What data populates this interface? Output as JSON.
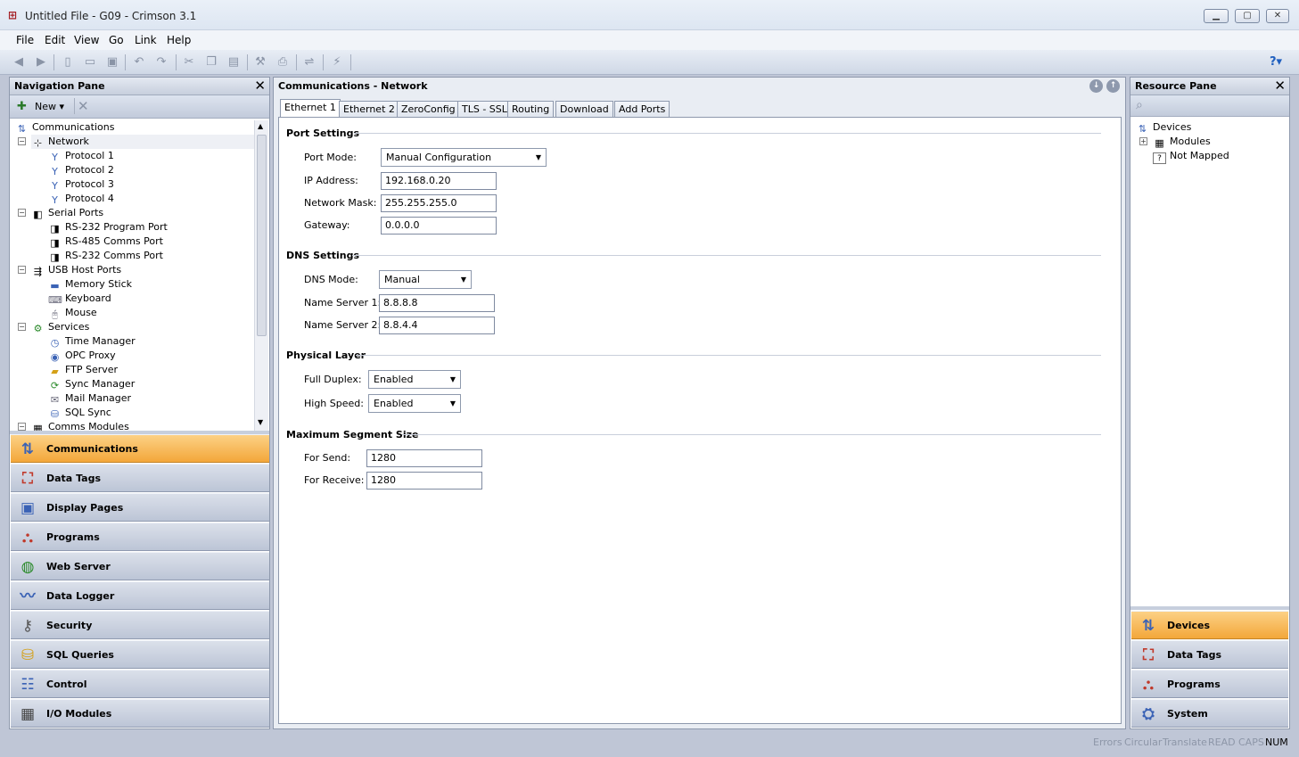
{
  "window": {
    "title": "Untitled File - G09 - Crimson 3.1"
  },
  "menu": [
    "File",
    "Edit",
    "View",
    "Go",
    "Link",
    "Help"
  ],
  "nav_pane": {
    "title": "Navigation Pane",
    "new_label": "New",
    "tree": [
      {
        "label": "Communications",
        "level": 0,
        "icon": "communications-icon"
      },
      {
        "label": "Network",
        "level": 1,
        "icon": "network-icon",
        "expanded": true
      },
      {
        "label": "Protocol 1",
        "level": 2,
        "icon": "protocol-icon"
      },
      {
        "label": "Protocol 2",
        "level": 2,
        "icon": "protocol-icon"
      },
      {
        "label": "Protocol 3",
        "level": 2,
        "icon": "protocol-icon"
      },
      {
        "label": "Protocol 4",
        "level": 2,
        "icon": "protocol-icon"
      },
      {
        "label": "Serial Ports",
        "level": 1,
        "icon": "serial-port-icon",
        "expanded": true
      },
      {
        "label": "RS-232 Program Port",
        "level": 2,
        "icon": "port-icon"
      },
      {
        "label": "RS-485 Comms Port",
        "level": 2,
        "icon": "port-icon"
      },
      {
        "label": "RS-232 Comms Port",
        "level": 2,
        "icon": "port-icon"
      },
      {
        "label": "USB Host Ports",
        "level": 1,
        "icon": "usb-icon",
        "expanded": true
      },
      {
        "label": "Memory Stick",
        "level": 2,
        "icon": "memory-stick-icon"
      },
      {
        "label": "Keyboard",
        "level": 2,
        "icon": "keyboard-icon"
      },
      {
        "label": "Mouse",
        "level": 2,
        "icon": "mouse-icon"
      },
      {
        "label": "Services",
        "level": 1,
        "icon": "services-icon",
        "expanded": true
      },
      {
        "label": "Time Manager",
        "level": 2,
        "icon": "clock-icon"
      },
      {
        "label": "OPC Proxy",
        "level": 2,
        "icon": "opc-icon"
      },
      {
        "label": "FTP Server",
        "level": 2,
        "icon": "ftp-icon"
      },
      {
        "label": "Sync Manager",
        "level": 2,
        "icon": "sync-icon"
      },
      {
        "label": "Mail Manager",
        "level": 2,
        "icon": "mail-icon"
      },
      {
        "label": "SQL Sync",
        "level": 2,
        "icon": "sql-sync-icon"
      },
      {
        "label": "Comms Modules",
        "level": 1,
        "icon": "modules-icon",
        "expanded": true
      }
    ],
    "buttons": [
      {
        "label": "Communications",
        "icon": "communications-icon",
        "selected": true
      },
      {
        "label": "Data Tags",
        "icon": "data-tags-icon"
      },
      {
        "label": "Display Pages",
        "icon": "display-pages-icon"
      },
      {
        "label": "Programs",
        "icon": "programs-icon"
      },
      {
        "label": "Web Server",
        "icon": "web-server-icon"
      },
      {
        "label": "Data Logger",
        "icon": "data-logger-icon"
      },
      {
        "label": "Security",
        "icon": "security-icon"
      },
      {
        "label": "SQL Queries",
        "icon": "sql-queries-icon"
      },
      {
        "label": "Control",
        "icon": "control-icon"
      },
      {
        "label": "I/O Modules",
        "icon": "io-modules-icon"
      }
    ]
  },
  "center": {
    "title": "Communications - Network",
    "tabs": [
      "Ethernet 1",
      "Ethernet 2",
      "ZeroConfig",
      "TLS - SSL",
      "Routing",
      "Download",
      "Add Ports"
    ],
    "port_settings": {
      "heading": "Port Settings",
      "port_mode_label": "Port Mode:",
      "port_mode_value": "Manual Configuration",
      "ip_label": "IP Address:",
      "ip_value": "192.168.0.20",
      "mask_label": "Network Mask:",
      "mask_value": "255.255.255.0",
      "gateway_label": "Gateway:",
      "gateway_value": "0.0.0.0"
    },
    "dns_settings": {
      "heading": "DNS Settings",
      "mode_label": "DNS Mode:",
      "mode_value": "Manual",
      "ns1_label": "Name Server 1:",
      "ns1_value": "8.8.8.8",
      "ns2_label": "Name Server 2:",
      "ns2_value": "8.8.4.4"
    },
    "physical_layer": {
      "heading": "Physical Layer",
      "duplex_label": "Full Duplex:",
      "duplex_value": "Enabled",
      "speed_label": "High Speed:",
      "speed_value": "Enabled"
    },
    "mss": {
      "heading": "Maximum Segment Size",
      "send_label": "For Send:",
      "send_value": "1280",
      "recv_label": "For Receive:",
      "recv_value": "1280"
    }
  },
  "resource_pane": {
    "title": "Resource Pane",
    "tree": [
      {
        "label": "Devices",
        "icon": "devices-icon"
      },
      {
        "label": "Modules",
        "icon": "modules-icon"
      },
      {
        "label": "Not Mapped",
        "icon": "question-icon"
      }
    ],
    "buttons": [
      {
        "label": "Devices",
        "selected": true
      },
      {
        "label": "Data Tags"
      },
      {
        "label": "Programs"
      },
      {
        "label": "System"
      }
    ]
  },
  "status": {
    "items": [
      "Errors",
      "Circular",
      "Translate",
      "READ",
      "CAPS",
      "NUM"
    ]
  }
}
